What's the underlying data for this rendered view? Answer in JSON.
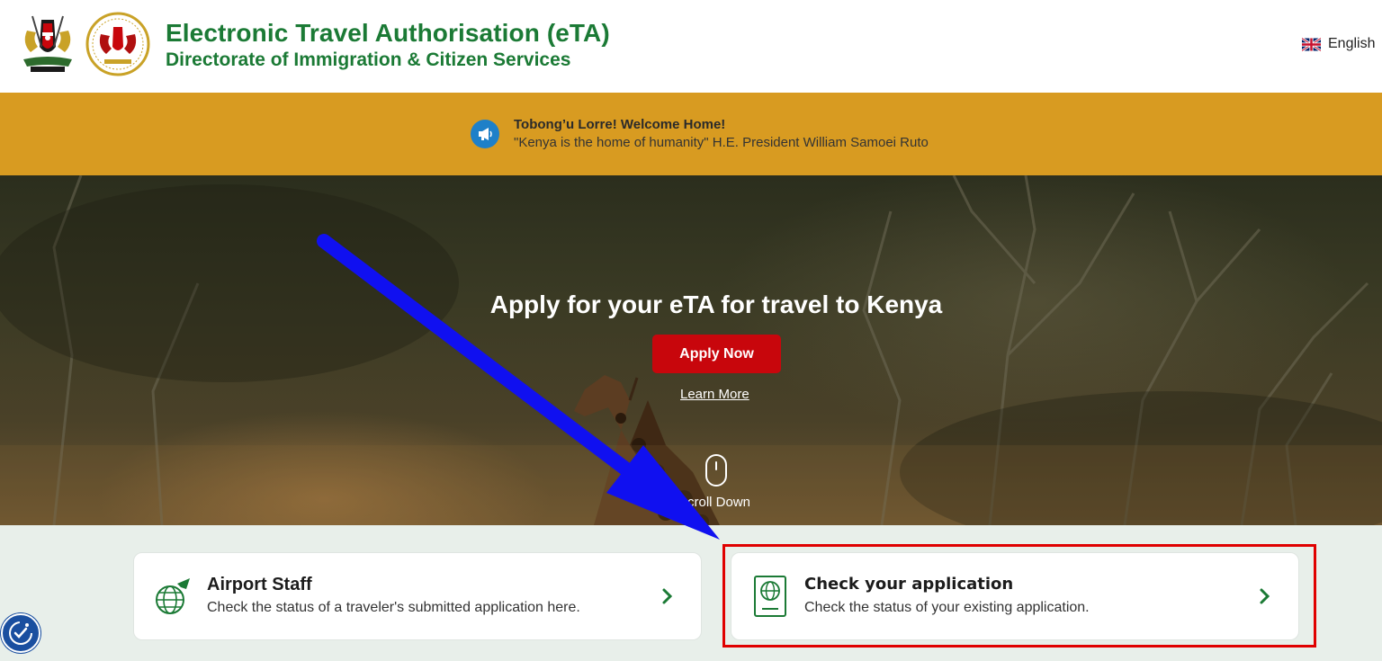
{
  "header": {
    "title": "Electronic Travel Authorisation (eTA)",
    "subtitle": "Directorate of Immigration & Citizen Services",
    "language": "English"
  },
  "banner": {
    "title": "Tobong’u Lorre! Welcome Home!",
    "quote": "\"Kenya is the home of humanity\" H.E. President William Samoei Ruto"
  },
  "hero": {
    "heading": "Apply for your eTA for travel to Kenya",
    "apply_label": "Apply Now",
    "learn_more_label": "Learn More",
    "scroll_label": "Scroll Down"
  },
  "cards": [
    {
      "title": "Airport Staff",
      "description": "Check the status of a traveler's submitted application here.",
      "icon": "airport-globe-icon"
    },
    {
      "title": "Check your application",
      "description": "Check the status of your existing application.",
      "icon": "passport-icon"
    }
  ],
  "colors": {
    "brand_green": "#1b7a35",
    "banner_gold": "#d89b21",
    "apply_red": "#c8060c",
    "annotation_blue": "#1010f0",
    "highlight_red": "#e00000"
  }
}
